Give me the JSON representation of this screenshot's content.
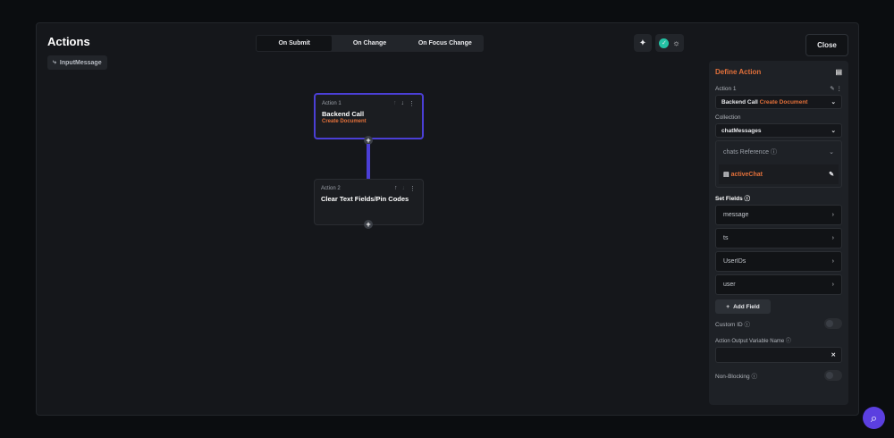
{
  "header": {
    "title": "Actions",
    "widget": "InputMessage",
    "close": "Close"
  },
  "tabs": [
    {
      "label": "On Submit",
      "active": true
    },
    {
      "label": "On Change"
    },
    {
      "label": "On Focus Change"
    }
  ],
  "nodes": [
    {
      "label": "Action 1",
      "name": "Backend Call",
      "sub": "Create Document"
    },
    {
      "label": "Action 2",
      "name": "Clear Text Fields/Pin Codes"
    }
  ],
  "panel": {
    "title": "Define Action",
    "action_label": "Action 1",
    "action_type": "Backend Call",
    "action_sub": "Create Document",
    "collection_label": "Collection",
    "collection": "chatMessages",
    "reference_label": "chats Reference",
    "reference_value": "activeChat",
    "set_fields_label": "Set Fields",
    "fields": [
      "message",
      "ts",
      "UserIDs",
      "user"
    ],
    "add_field": "Add Field",
    "custom_id": "Custom ID",
    "output_var_label": "Action Output Variable Name",
    "output_var_value": "",
    "non_blocking": "Non-Blocking"
  },
  "colors": {
    "accent": "#4b3fd6",
    "orange": "#e2703a"
  }
}
